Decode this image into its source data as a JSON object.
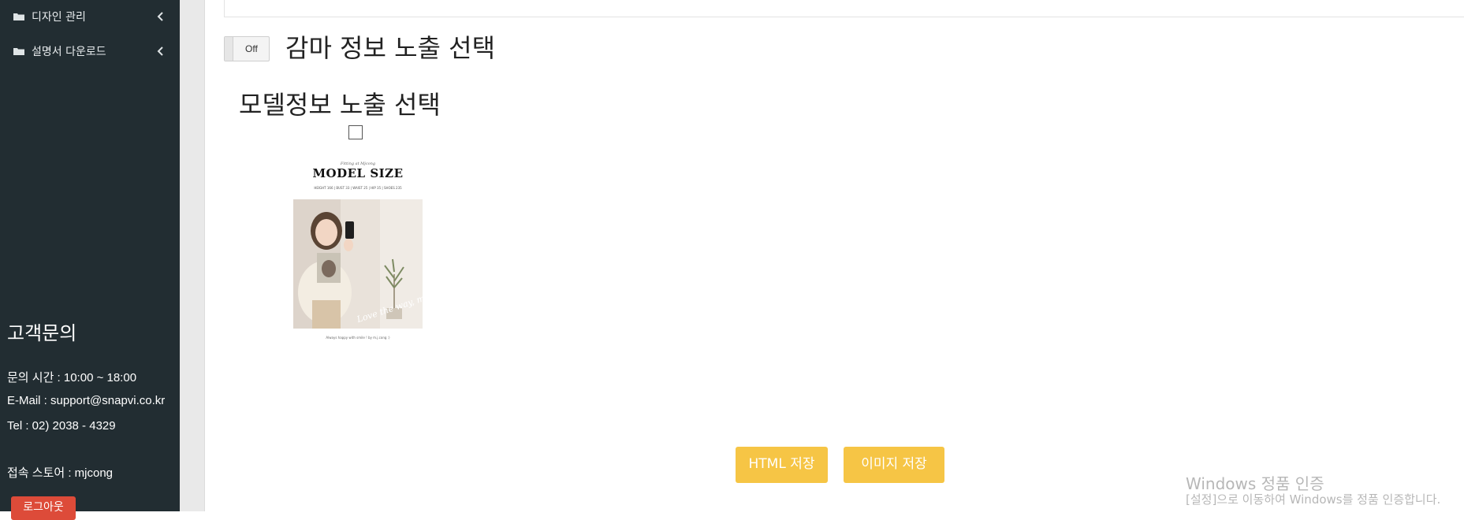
{
  "sidebar": {
    "items": [
      {
        "label": "디자인 관리",
        "icon": "folder-icon",
        "chevron": "chevron-left-icon"
      },
      {
        "label": "설명서 다운로드",
        "icon": "folder-icon",
        "chevron": "chevron-left-icon"
      }
    ],
    "customer_support": {
      "title": "고객문의",
      "hours": "문의 시간 : 10:00 ~ 18:00",
      "email": "E-Mail : support@snapvi.co.kr",
      "tel": "Tel : 02) 2038 - 4329",
      "store": "접속 스토어 : mjcong"
    },
    "logout_label": "로그아웃",
    "logout_color": "#dd4b39",
    "bg_color": "#222d32"
  },
  "main": {
    "gamma_toggle": {
      "state_label": "Off",
      "title": "감마 정보 노출 선택"
    },
    "model_info": {
      "title": "모델정보 노출 선택",
      "checked": false
    },
    "thumbnail": {
      "kicker": "Fitting at Mjcong",
      "heading": "MODEL SIZE",
      "spec": "HEIGHT 166 | BUST 33 | WAIST 25 | HIP 35 | SHOES 235",
      "caption": "Always happy with smile ! by m.j.cong :)",
      "overlay_script": "Love the way, mjcong :)"
    },
    "buttons": {
      "save_html": "HTML 저장",
      "save_image": "이미지 저장",
      "color": "#f6c545"
    }
  },
  "watermark": {
    "title": "Windows 정품 인증",
    "subtitle": "[설정]으로 이동하여 Windows를 정품 인증합니다."
  }
}
